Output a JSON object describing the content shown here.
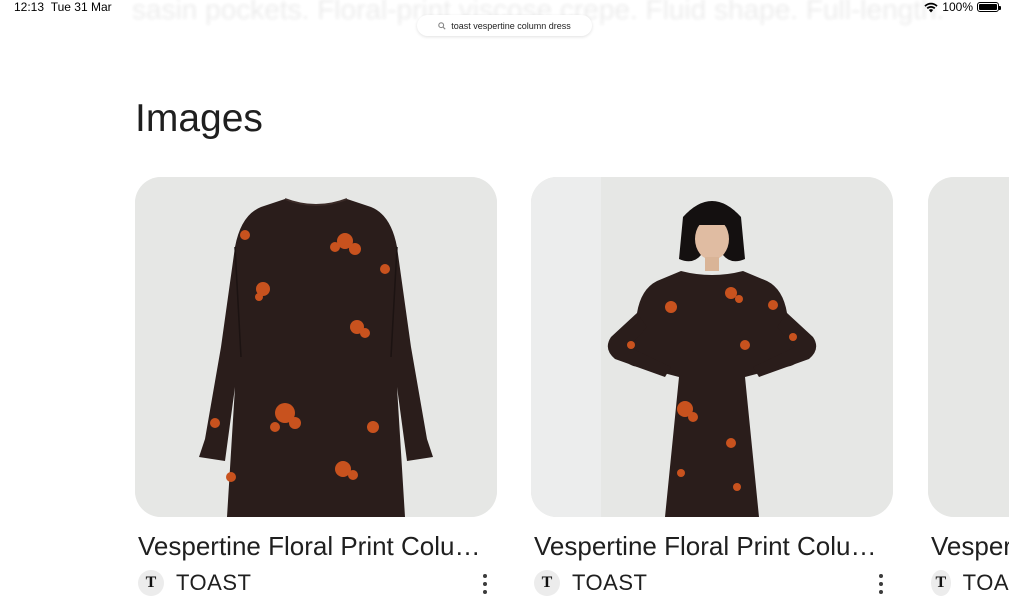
{
  "status_bar": {
    "time": "12:13",
    "date": "Tue 31 Mar",
    "battery": "100%"
  },
  "background_text": "sasin pockets. Floral-print viscose crepe. Fluid shape. Full-length.",
  "address_bar": {
    "query": "toast vespertine column dress",
    "icon": "search-icon"
  },
  "section_title": "Images",
  "cards": [
    {
      "title": "Vespertine Floral Print Colu…",
      "source": "TOAST",
      "favicon_letter": "T"
    },
    {
      "title": "Vespertine Floral Print Colu…",
      "source": "TOAST",
      "favicon_letter": "T"
    },
    {
      "title": "Vesper",
      "source": "TOA",
      "favicon_letter": "T"
    }
  ],
  "colors": {
    "dress": "#2a1d1b",
    "floral": "#c8521e",
    "image_bg": "#e6e7e5"
  }
}
